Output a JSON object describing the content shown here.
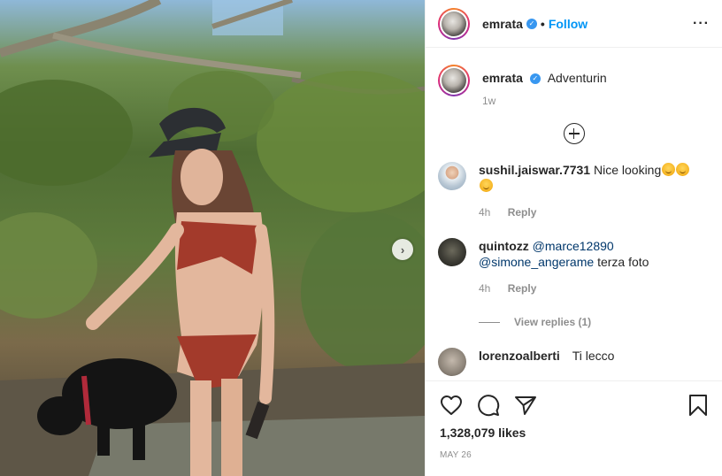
{
  "post": {
    "author": "emrata",
    "follow_label": "Follow",
    "separator": "•",
    "more_label": "···",
    "caption": {
      "username": "emrata",
      "text": "Adventurin",
      "time": "1w"
    },
    "comments": [
      {
        "username": "sushil.jaiswar.7731",
        "text": "Nice looking",
        "time": "4h",
        "reply_label": "Reply"
      },
      {
        "username": "quintozz",
        "mention1": "@marce12890",
        "mention2": "@simone_angerame",
        "text": "terza foto",
        "time": "4h",
        "reply_label": "Reply",
        "view_replies": "View replies (1)"
      },
      {
        "username": "lorenzoalberti",
        "text": "Ti lecco"
      }
    ],
    "likes": "1,328,079 likes",
    "date": "MAY 26"
  },
  "colors": {
    "accent": "#0095f6",
    "verified": "#3897f0",
    "muted": "#8e8e8e"
  },
  "icons": [
    "heart-icon",
    "comment-icon",
    "share-icon",
    "bookmark-icon",
    "more-icon",
    "plus-circle-icon",
    "chevron-right-icon",
    "verified-badge-icon"
  ]
}
